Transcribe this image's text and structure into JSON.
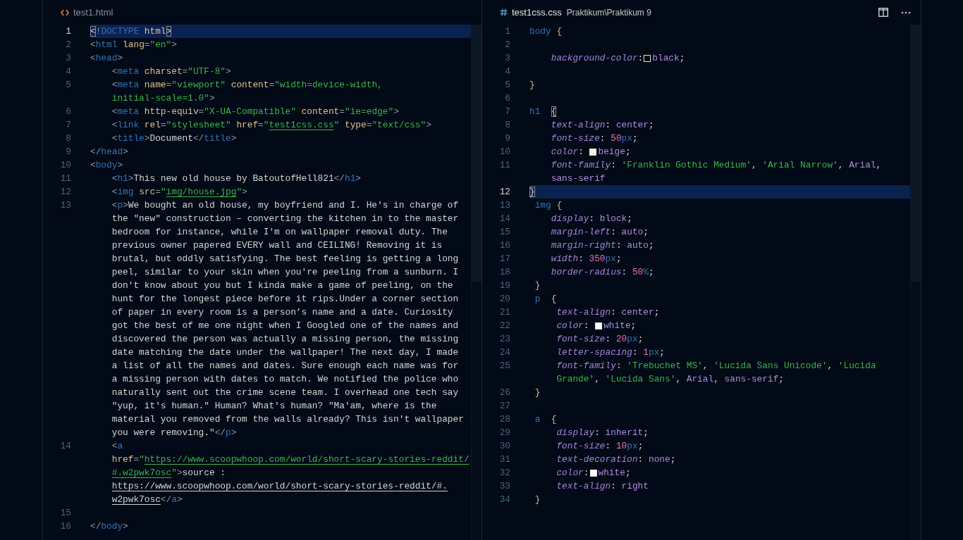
{
  "editors": [
    {
      "kind": "html",
      "active": false,
      "tab": {
        "file": "test1.html"
      },
      "lines": [
        {
          "n": "1",
          "current": true,
          "rows": [
            {
              "tokens": [
                {
                  "kind": "match",
                  "text": "<"
                },
                {
                  "kind": "punct",
                  "text": "!"
                },
                {
                  "kind": "keyword",
                  "text": "DOCTYPE"
                },
                {
                  "kind": "attr",
                  "text": " html"
                },
                {
                  "kind": "match",
                  "text": ">"
                }
              ]
            }
          ]
        },
        {
          "n": "2",
          "current": false,
          "rows": [
            {
              "tokens": [
                {
                  "kind": "punct",
                  "text": "<"
                },
                {
                  "kind": "tag",
                  "text": "html"
                },
                {
                  "kind": "attr",
                  "text": " lang"
                },
                {
                  "kind": "punct",
                  "text": "="
                },
                {
                  "kind": "string",
                  "text": "\"en\""
                },
                {
                  "kind": "punct",
                  "text": ">"
                }
              ]
            }
          ]
        },
        {
          "n": "3",
          "current": false,
          "rows": [
            {
              "tokens": [
                {
                  "kind": "punct",
                  "text": "<"
                },
                {
                  "kind": "tag",
                  "text": "head"
                },
                {
                  "kind": "punct",
                  "text": ">"
                }
              ]
            }
          ]
        },
        {
          "n": "4",
          "current": false,
          "rows": [
            {
              "tokens": [
                {
                  "kind": "punct",
                  "text": "    <"
                },
                {
                  "kind": "tag",
                  "text": "meta"
                },
                {
                  "kind": "attr",
                  "text": " charset"
                },
                {
                  "kind": "punct",
                  "text": "="
                },
                {
                  "kind": "string",
                  "text": "\"UTF-8\""
                },
                {
                  "kind": "punct",
                  "text": ">"
                }
              ]
            }
          ]
        },
        {
          "n": "5",
          "current": false,
          "rows": [
            {
              "tokens": [
                {
                  "kind": "punct",
                  "text": "    <"
                },
                {
                  "kind": "tag",
                  "text": "meta"
                },
                {
                  "kind": "attr",
                  "text": " name"
                },
                {
                  "kind": "punct",
                  "text": "="
                },
                {
                  "kind": "string",
                  "text": "\"viewport\""
                },
                {
                  "kind": "attr",
                  "text": " content"
                },
                {
                  "kind": "punct",
                  "text": "="
                },
                {
                  "kind": "string",
                  "text": "\"width=device-width,"
                }
              ]
            },
            {
              "tokens": [
                {
                  "kind": "string",
                  "text": "    initial-scale=1.0\""
                },
                {
                  "kind": "punct",
                  "text": ">"
                }
              ]
            }
          ]
        },
        {
          "n": "6",
          "current": false,
          "rows": [
            {
              "tokens": [
                {
                  "kind": "punct",
                  "text": "    <"
                },
                {
                  "kind": "tag",
                  "text": "meta"
                },
                {
                  "kind": "attr",
                  "text": " http-equiv"
                },
                {
                  "kind": "punct",
                  "text": "="
                },
                {
                  "kind": "string",
                  "text": "\"X-UA-Compatible\""
                },
                {
                  "kind": "attr",
                  "text": " content"
                },
                {
                  "kind": "punct",
                  "text": "="
                },
                {
                  "kind": "string",
                  "text": "\"ie=edge\""
                },
                {
                  "kind": "punct",
                  "text": ">"
                }
              ]
            }
          ]
        },
        {
          "n": "7",
          "current": false,
          "rows": [
            {
              "tokens": [
                {
                  "kind": "punct",
                  "text": "    <"
                },
                {
                  "kind": "tag",
                  "text": "link"
                },
                {
                  "kind": "attr",
                  "text": " rel"
                },
                {
                  "kind": "punct",
                  "text": "="
                },
                {
                  "kind": "string",
                  "text": "\"stylesheet\""
                },
                {
                  "kind": "attr",
                  "text": " href"
                },
                {
                  "kind": "punct",
                  "text": "="
                },
                {
                  "kind": "string",
                  "text": "\""
                },
                {
                  "kind": "link",
                  "text": "test1css.css"
                },
                {
                  "kind": "string",
                  "text": "\""
                },
                {
                  "kind": "attr",
                  "text": " type"
                },
                {
                  "kind": "punct",
                  "text": "="
                },
                {
                  "kind": "string",
                  "text": "\"text/css\""
                },
                {
                  "kind": "punct",
                  "text": ">"
                }
              ]
            }
          ]
        },
        {
          "n": "8",
          "current": false,
          "rows": [
            {
              "tokens": [
                {
                  "kind": "punct",
                  "text": "    <"
                },
                {
                  "kind": "tag",
                  "text": "title"
                },
                {
                  "kind": "punct",
                  "text": ">"
                },
                {
                  "kind": "text",
                  "text": "Document"
                },
                {
                  "kind": "punct",
                  "text": "</"
                },
                {
                  "kind": "tag",
                  "text": "title"
                },
                {
                  "kind": "punct",
                  "text": ">"
                }
              ]
            }
          ]
        },
        {
          "n": "9",
          "current": false,
          "rows": [
            {
              "tokens": [
                {
                  "kind": "punct",
                  "text": "</"
                },
                {
                  "kind": "tag",
                  "text": "head"
                },
                {
                  "kind": "punct",
                  "text": ">"
                }
              ]
            }
          ]
        },
        {
          "n": "10",
          "current": false,
          "rows": [
            {
              "tokens": [
                {
                  "kind": "punct",
                  "text": "<"
                },
                {
                  "kind": "tag",
                  "text": "body"
                },
                {
                  "kind": "punct",
                  "text": ">"
                }
              ]
            }
          ]
        },
        {
          "n": "11",
          "current": false,
          "rows": [
            {
              "tokens": [
                {
                  "kind": "punct",
                  "text": "    <"
                },
                {
                  "kind": "tag",
                  "text": "h1"
                },
                {
                  "kind": "punct",
                  "text": ">"
                },
                {
                  "kind": "text",
                  "text": "This new old house by BatoutofHell821"
                },
                {
                  "kind": "punct",
                  "text": "</"
                },
                {
                  "kind": "tag",
                  "text": "h1"
                },
                {
                  "kind": "punct",
                  "text": ">"
                }
              ]
            }
          ]
        },
        {
          "n": "12",
          "current": false,
          "rows": [
            {
              "tokens": [
                {
                  "kind": "punct",
                  "text": "    <"
                },
                {
                  "kind": "tag",
                  "text": "img"
                },
                {
                  "kind": "attr",
                  "text": " src"
                },
                {
                  "kind": "punct",
                  "text": "="
                },
                {
                  "kind": "string",
                  "text": "\""
                },
                {
                  "kind": "link",
                  "text": "img/house.jpg"
                },
                {
                  "kind": "string",
                  "text": "\""
                },
                {
                  "kind": "punct",
                  "text": ">"
                }
              ]
            }
          ]
        },
        {
          "n": "13",
          "current": false,
          "rows": [
            {
              "tokens": [
                {
                  "kind": "punct",
                  "text": "    <"
                },
                {
                  "kind": "tag",
                  "text": "p"
                },
                {
                  "kind": "punct",
                  "text": ">"
                },
                {
                  "kind": "text",
                  "text": "We bought an old house, my boyfriend and I. He's in charge of"
                }
              ]
            },
            {
              "tokens": [
                {
                  "kind": "text",
                  "text": "    the \"new\" construction – converting the kitchen in to the master"
                }
              ]
            },
            {
              "tokens": [
                {
                  "kind": "text",
                  "text": "    bedroom for instance, while I'm on wallpaper removal duty. The"
                }
              ]
            },
            {
              "tokens": [
                {
                  "kind": "text",
                  "text": "    previous owner papered EVERY wall and CEILING! Removing it is"
                }
              ]
            },
            {
              "tokens": [
                {
                  "kind": "text",
                  "text": "    brutal, but oddly satisfying. The best feeling is getting a long"
                }
              ]
            },
            {
              "tokens": [
                {
                  "kind": "text",
                  "text": "    peel, similar to your skin when you're peeling from a sunburn. I"
                }
              ]
            },
            {
              "tokens": [
                {
                  "kind": "text",
                  "text": "    don't know about you but I kinda make a game of peeling, on the"
                }
              ]
            },
            {
              "tokens": [
                {
                  "kind": "text",
                  "text": "    hunt for the longest piece before it rips.Under a corner section"
                }
              ]
            },
            {
              "tokens": [
                {
                  "kind": "text",
                  "text": "    of paper in every room is a person’s name and a date. Curiosity"
                }
              ]
            },
            {
              "tokens": [
                {
                  "kind": "text",
                  "text": "    got the best of me one night when I Googled one of the names and"
                }
              ]
            },
            {
              "tokens": [
                {
                  "kind": "text",
                  "text": "    discovered the person was actually a missing person, the missing"
                }
              ]
            },
            {
              "tokens": [
                {
                  "kind": "text",
                  "text": "    date matching the date under the wallpaper! The next day, I made"
                }
              ]
            },
            {
              "tokens": [
                {
                  "kind": "text",
                  "text": "    a list of all the names and dates. Sure enough each name was for"
                }
              ]
            },
            {
              "tokens": [
                {
                  "kind": "text",
                  "text": "    a missing person with dates to match. We notified the police who"
                }
              ]
            },
            {
              "tokens": [
                {
                  "kind": "text",
                  "text": "    naturally sent out the crime scene team. I overhead one tech say"
                }
              ]
            },
            {
              "tokens": [
                {
                  "kind": "text",
                  "text": "    \"yup, it's human.\" Human? What's human? \"Ma'am, where is the"
                }
              ]
            },
            {
              "tokens": [
                {
                  "kind": "text",
                  "text": "    material you removed from the walls already? This isn't wallpaper"
                }
              ]
            },
            {
              "tokens": [
                {
                  "kind": "text",
                  "text": "    you were removing.\""
                },
                {
                  "kind": "punct",
                  "text": "</"
                },
                {
                  "kind": "tag",
                  "text": "p"
                },
                {
                  "kind": "punct",
                  "text": ">"
                }
              ]
            }
          ]
        },
        {
          "n": "14",
          "current": false,
          "rows": [
            {
              "tokens": [
                {
                  "kind": "punct",
                  "text": "    <"
                },
                {
                  "kind": "tag",
                  "text": "a"
                }
              ]
            },
            {
              "tokens": [
                {
                  "kind": "attr",
                  "text": "    href"
                },
                {
                  "kind": "punct",
                  "text": "="
                },
                {
                  "kind": "string",
                  "text": "\""
                },
                {
                  "kind": "link",
                  "text": "https://www.scoopwhoop.com/world/short-scary-stories-reddit/"
                }
              ]
            },
            {
              "tokens": [
                {
                  "kind": "link",
                  "text": "    #.w2pwk7osc"
                },
                {
                  "kind": "string",
                  "text": "\""
                },
                {
                  "kind": "punct",
                  "text": ">"
                },
                {
                  "kind": "text",
                  "text": "source :"
                }
              ]
            },
            {
              "tokens": [
                {
                  "kind": "linktext",
                  "text": "    https://www.scoopwhoop.com/world/short-scary-stories-reddit/#."
                }
              ]
            },
            {
              "tokens": [
                {
                  "kind": "linktext",
                  "text": "    w2pwk7osc"
                },
                {
                  "kind": "punct",
                  "text": "</"
                },
                {
                  "kind": "tag",
                  "text": "a"
                },
                {
                  "kind": "punct",
                  "text": ">"
                }
              ]
            }
          ]
        },
        {
          "n": "15",
          "current": false
        },
        {
          "n": "16",
          "current": false,
          "rows": [
            {
              "tokens": [
                {
                  "kind": "punct",
                  "text": "</"
                },
                {
                  "kind": "tag",
                  "text": "body"
                },
                {
                  "kind": "punct",
                  "text": ">"
                }
              ]
            }
          ]
        }
      ]
    },
    {
      "kind": "css",
      "active": true,
      "tab": {
        "file": "test1css.css",
        "path": "Praktikum\\Praktikum 9"
      },
      "lines": [
        {
          "n": "1",
          "current": false,
          "rows": [
            {
              "tokens": [
                {
                  "kind": "selector",
                  "text": "body"
                },
                {
                  "kind": "brace",
                  "text": " {"
                }
              ]
            }
          ]
        },
        {
          "n": "2",
          "current": false
        },
        {
          "n": "3",
          "current": false,
          "rows": [
            {
              "tokens": [
                {
                  "kind": "property",
                  "text": "    background-color"
                },
                {
                  "kind": "text",
                  "text": ":"
                },
                {
                  "kind": "swatch",
                  "color": "#000000"
                },
                {
                  "kind": "value",
                  "text": "black"
                },
                {
                  "kind": "text",
                  "text": ";"
                }
              ]
            }
          ]
        },
        {
          "n": "4",
          "current": false
        },
        {
          "n": "5",
          "current": false,
          "rows": [
            {
              "tokens": [
                {
                  "kind": "brace",
                  "text": "}"
                }
              ]
            }
          ]
        },
        {
          "n": "6",
          "current": false
        },
        {
          "n": "7",
          "current": false,
          "rows": [
            {
              "tokens": [
                {
                  "kind": "selector",
                  "text": "h1  "
                },
                {
                  "kind": "match",
                  "text": "{"
                }
              ]
            }
          ]
        },
        {
          "n": "8",
          "current": false,
          "rows": [
            {
              "tokens": [
                {
                  "kind": "property",
                  "text": "    text-align"
                },
                {
                  "kind": "text",
                  "text": ":"
                },
                {
                  "kind": "value",
                  "text": " center"
                },
                {
                  "kind": "text",
                  "text": ";"
                }
              ]
            }
          ]
        },
        {
          "n": "9",
          "current": false,
          "rows": [
            {
              "tokens": [
                {
                  "kind": "property",
                  "text": "    font-size"
                },
                {
                  "kind": "text",
                  "text": ":"
                },
                {
                  "kind": "number",
                  "text": " 50"
                },
                {
                  "kind": "unit",
                  "text": "px"
                },
                {
                  "kind": "text",
                  "text": ";"
                }
              ]
            }
          ]
        },
        {
          "n": "10",
          "current": false,
          "rows": [
            {
              "tokens": [
                {
                  "kind": "property",
                  "text": "    color"
                },
                {
                  "kind": "text",
                  "text": ": "
                },
                {
                  "kind": "swatch",
                  "color": "#f5f5dc"
                },
                {
                  "kind": "value",
                  "text": "beige"
                },
                {
                  "kind": "text",
                  "text": ";"
                }
              ]
            }
          ]
        },
        {
          "n": "11",
          "current": false,
          "rows": [
            {
              "tokens": [
                {
                  "kind": "property",
                  "text": "    font-family"
                },
                {
                  "kind": "text",
                  "text": ":"
                },
                {
                  "kind": "string",
                  "text": " 'Franklin Gothic Medium'"
                },
                {
                  "kind": "text",
                  "text": ","
                },
                {
                  "kind": "string",
                  "text": " 'Arial Narrow'"
                },
                {
                  "kind": "text",
                  "text": ","
                },
                {
                  "kind": "value",
                  "text": " Arial"
                },
                {
                  "kind": "text",
                  "text": ","
                }
              ]
            },
            {
              "tokens": [
                {
                  "kind": "value",
                  "text": "    sans-serif"
                }
              ]
            }
          ]
        },
        {
          "n": "12",
          "current": true,
          "rows": [
            {
              "tokens": [
                {
                  "kind": "match",
                  "text": "}"
                }
              ]
            }
          ]
        },
        {
          "n": "13",
          "current": false,
          "rows": [
            {
              "tokens": [
                {
                  "kind": "selector",
                  "text": " img"
                },
                {
                  "kind": "brace",
                  "text": " {"
                }
              ]
            }
          ]
        },
        {
          "n": "14",
          "current": false,
          "rows": [
            {
              "tokens": [
                {
                  "kind": "property",
                  "text": "    display"
                },
                {
                  "kind": "text",
                  "text": ":"
                },
                {
                  "kind": "value",
                  "text": " block"
                },
                {
                  "kind": "text",
                  "text": ";"
                }
              ]
            }
          ]
        },
        {
          "n": "15",
          "current": false,
          "rows": [
            {
              "tokens": [
                {
                  "kind": "property",
                  "text": "    margin-left"
                },
                {
                  "kind": "text",
                  "text": ":"
                },
                {
                  "kind": "value",
                  "text": " auto"
                },
                {
                  "kind": "text",
                  "text": ";"
                }
              ]
            }
          ]
        },
        {
          "n": "16",
          "current": false,
          "rows": [
            {
              "tokens": [
                {
                  "kind": "property",
                  "text": "    margin-right"
                },
                {
                  "kind": "text",
                  "text": ":"
                },
                {
                  "kind": "value",
                  "text": " auto"
                },
                {
                  "kind": "text",
                  "text": ";"
                }
              ]
            }
          ]
        },
        {
          "n": "17",
          "current": false,
          "rows": [
            {
              "tokens": [
                {
                  "kind": "property",
                  "text": "    width"
                },
                {
                  "kind": "text",
                  "text": ":"
                },
                {
                  "kind": "number",
                  "text": " 350"
                },
                {
                  "kind": "unit",
                  "text": "px"
                },
                {
                  "kind": "text",
                  "text": ";"
                }
              ]
            }
          ]
        },
        {
          "n": "18",
          "current": false,
          "rows": [
            {
              "tokens": [
                {
                  "kind": "property",
                  "text": "    border-radius"
                },
                {
                  "kind": "text",
                  "text": ":"
                },
                {
                  "kind": "number",
                  "text": " 50"
                },
                {
                  "kind": "unit",
                  "text": "%"
                },
                {
                  "kind": "text",
                  "text": ";"
                }
              ]
            }
          ]
        },
        {
          "n": "19",
          "current": false,
          "rows": [
            {
              "tokens": [
                {
                  "kind": "brace",
                  "text": " }"
                }
              ]
            }
          ]
        },
        {
          "n": "20",
          "current": false,
          "rows": [
            {
              "tokens": [
                {
                  "kind": "selector",
                  "text": " p"
                },
                {
                  "kind": "brace",
                  "text": "  {"
                }
              ]
            }
          ]
        },
        {
          "n": "21",
          "current": false,
          "rows": [
            {
              "tokens": [
                {
                  "kind": "property",
                  "text": "     text-align"
                },
                {
                  "kind": "text",
                  "text": ":"
                },
                {
                  "kind": "value",
                  "text": " center"
                },
                {
                  "kind": "text",
                  "text": ";"
                }
              ]
            }
          ]
        },
        {
          "n": "22",
          "current": false,
          "rows": [
            {
              "tokens": [
                {
                  "kind": "property",
                  "text": "     color"
                },
                {
                  "kind": "text",
                  "text": ": "
                },
                {
                  "kind": "swatch",
                  "color": "#ffffff"
                },
                {
                  "kind": "value",
                  "text": "white"
                },
                {
                  "kind": "text",
                  "text": ";"
                }
              ]
            }
          ]
        },
        {
          "n": "23",
          "current": false,
          "rows": [
            {
              "tokens": [
                {
                  "kind": "property",
                  "text": "     font-size"
                },
                {
                  "kind": "text",
                  "text": ":"
                },
                {
                  "kind": "number",
                  "text": " 20"
                },
                {
                  "kind": "unit",
                  "text": "px"
                },
                {
                  "kind": "text",
                  "text": ";"
                }
              ]
            }
          ]
        },
        {
          "n": "24",
          "current": false,
          "rows": [
            {
              "tokens": [
                {
                  "kind": "property",
                  "text": "     letter-spacing"
                },
                {
                  "kind": "text",
                  "text": ":"
                },
                {
                  "kind": "number",
                  "text": " 1"
                },
                {
                  "kind": "unit",
                  "text": "px"
                },
                {
                  "kind": "text",
                  "text": ";"
                }
              ]
            }
          ]
        },
        {
          "n": "25",
          "current": false,
          "rows": [
            {
              "tokens": [
                {
                  "kind": "property",
                  "text": "     font-family"
                },
                {
                  "kind": "text",
                  "text": ":"
                },
                {
                  "kind": "string",
                  "text": " 'Trebuchet MS'"
                },
                {
                  "kind": "text",
                  "text": ","
                },
                {
                  "kind": "string",
                  "text": " 'Lucida Sans Unicode'"
                },
                {
                  "kind": "text",
                  "text": ","
                },
                {
                  "kind": "string",
                  "text": " 'Lucida"
                }
              ]
            },
            {
              "tokens": [
                {
                  "kind": "string",
                  "text": "     Grande'"
                },
                {
                  "kind": "text",
                  "text": ","
                },
                {
                  "kind": "string",
                  "text": " 'Lucida Sans'"
                },
                {
                  "kind": "text",
                  "text": ","
                },
                {
                  "kind": "value",
                  "text": " Arial"
                },
                {
                  "kind": "text",
                  "text": ","
                },
                {
                  "kind": "value",
                  "text": " sans-serif"
                },
                {
                  "kind": "text",
                  "text": ";"
                }
              ]
            }
          ]
        },
        {
          "n": "26",
          "current": false,
          "rows": [
            {
              "tokens": [
                {
                  "kind": "brace",
                  "text": " }"
                }
              ]
            }
          ]
        },
        {
          "n": "27",
          "current": false
        },
        {
          "n": "28",
          "current": false,
          "rows": [
            {
              "tokens": [
                {
                  "kind": "selector",
                  "text": " a"
                },
                {
                  "kind": "brace",
                  "text": "  {"
                }
              ]
            }
          ]
        },
        {
          "n": "29",
          "current": false,
          "rows": [
            {
              "tokens": [
                {
                  "kind": "property",
                  "text": "     display"
                },
                {
                  "kind": "text",
                  "text": ":"
                },
                {
                  "kind": "value",
                  "text": " inherit"
                },
                {
                  "kind": "text",
                  "text": ";"
                }
              ]
            }
          ]
        },
        {
          "n": "30",
          "current": false,
          "rows": [
            {
              "tokens": [
                {
                  "kind": "property",
                  "text": "     font-size"
                },
                {
                  "kind": "text",
                  "text": ":"
                },
                {
                  "kind": "number",
                  "text": " 10"
                },
                {
                  "kind": "unit",
                  "text": "px"
                },
                {
                  "kind": "text",
                  "text": ";"
                }
              ]
            }
          ]
        },
        {
          "n": "31",
          "current": false,
          "rows": [
            {
              "tokens": [
                {
                  "kind": "property",
                  "text": "     text-decoration"
                },
                {
                  "kind": "text",
                  "text": ":"
                },
                {
                  "kind": "value",
                  "text": " none"
                },
                {
                  "kind": "text",
                  "text": ";"
                }
              ]
            }
          ]
        },
        {
          "n": "32",
          "current": false,
          "rows": [
            {
              "tokens": [
                {
                  "kind": "property",
                  "text": "     color"
                },
                {
                  "kind": "text",
                  "text": ":"
                },
                {
                  "kind": "swatch",
                  "color": "#ffffff"
                },
                {
                  "kind": "value",
                  "text": "white"
                },
                {
                  "kind": "text",
                  "text": ";"
                }
              ]
            }
          ]
        },
        {
          "n": "33",
          "current": false,
          "rows": [
            {
              "tokens": [
                {
                  "kind": "property",
                  "text": "     text-align"
                },
                {
                  "kind": "text",
                  "text": ":"
                },
                {
                  "kind": "value",
                  "text": " right"
                }
              ]
            }
          ]
        },
        {
          "n": "34",
          "current": false,
          "rows": [
            {
              "tokens": [
                {
                  "kind": "brace",
                  "text": " }"
                }
              ]
            }
          ]
        }
      ]
    }
  ]
}
